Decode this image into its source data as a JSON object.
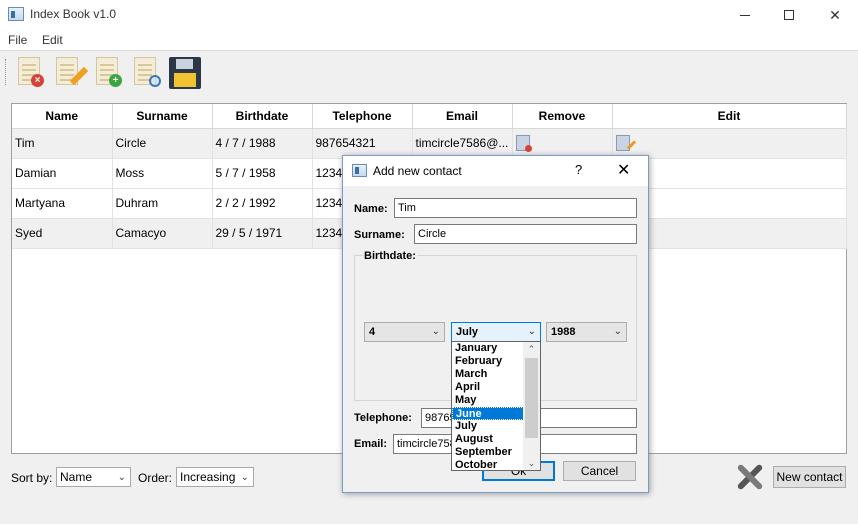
{
  "window": {
    "title": "Index Book v1.0"
  },
  "menu": {
    "file": "File",
    "edit": "Edit"
  },
  "toolbar": {
    "items": [
      {
        "name": "delete-contact",
        "icon": "document-delete-icon"
      },
      {
        "name": "edit-contact",
        "icon": "document-edit-icon"
      },
      {
        "name": "add-contact",
        "icon": "document-add-icon"
      },
      {
        "name": "search-contact",
        "icon": "document-search-icon"
      },
      {
        "name": "save",
        "icon": "floppy-disk-icon"
      }
    ]
  },
  "table": {
    "headers": [
      "Name",
      "Surname",
      "Birthdate",
      "Telephone",
      "Email",
      "Remove",
      "Edit"
    ],
    "rows": [
      {
        "name": "Tim",
        "surname": "Circle",
        "birthdate": "4 / 7 / 1988",
        "telephone": "987654321",
        "email": "timcircle7586@..."
      },
      {
        "name": "Damian",
        "surname": "Moss",
        "birthdate": "5 / 7 / 1958",
        "telephone": "12345",
        "email": ""
      },
      {
        "name": "Martyana",
        "surname": "Duhram",
        "birthdate": "2 / 2 / 1992",
        "telephone": "12345",
        "email": ""
      },
      {
        "name": "Syed",
        "surname": "Camacyo",
        "birthdate": "29 / 5 / 1971",
        "telephone": "12345",
        "email": ""
      }
    ]
  },
  "footer": {
    "sort_label": "Sort by:",
    "sort_value": "Name",
    "order_label": "Order:",
    "order_value": "Increasing",
    "new_contact": "New contact"
  },
  "dialog": {
    "title": "Add new contact",
    "help": "?",
    "close": "✕",
    "name_label": "Name:",
    "name_value": "Tim",
    "surname_label": "Surname:",
    "surname_value": "Circle",
    "birthdate_label": "Birthdate:",
    "day_value": "4",
    "month_value": "July",
    "year_value": "1988",
    "telephone_label": "Telephone:",
    "telephone_value": "98765",
    "email_label": "Email:",
    "email_value": "timcircle758",
    "ok": "Ok",
    "cancel": "Cancel"
  },
  "month_dropdown": {
    "options": [
      "January",
      "February",
      "March",
      "April",
      "May",
      "June",
      "July",
      "August",
      "September",
      "October"
    ],
    "highlighted": "June"
  },
  "colors": {
    "accent": "#0078d7",
    "row_alt": "#f0f0f0"
  }
}
